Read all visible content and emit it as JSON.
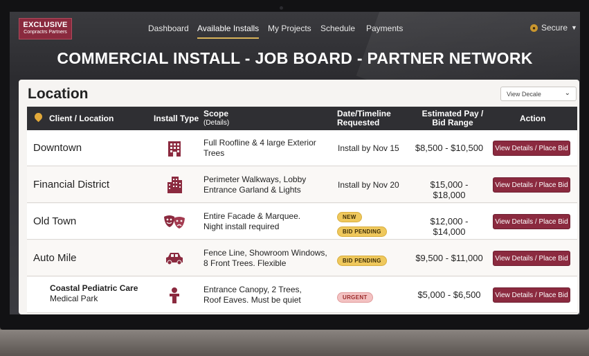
{
  "brand": {
    "line1": "EXCLUSIVE",
    "line2": "Conpractrs Partners"
  },
  "nav": {
    "items": [
      "Dashboard",
      "Available Installs",
      "My Projects",
      "Schedule",
      "Payments"
    ],
    "active": "Available Installs",
    "secure_label": "Secure"
  },
  "page_title": "COMMERCIAL INSTALL - JOB BOARD - PARTNER NETWORK",
  "panel": {
    "heading": "Location",
    "view_select": "View Decale"
  },
  "table": {
    "headers": {
      "location": "Client / Location",
      "install_type": "Install Type",
      "scope": "Scope",
      "scope_sub": "(Details)",
      "timeline_1": "Date/Timeline",
      "timeline_2": "Requested",
      "pay_1": "Estimated Pay /",
      "pay_2": "Bid Range",
      "action": "Action"
    },
    "rows": [
      {
        "location": "Downtown",
        "icon": "office-building-icon",
        "scope_1": "Full Roofline & 4 large Exterior",
        "scope_2": "Trees",
        "timeline": "Install by Nov 15",
        "pay": "$8,500 - $10,500",
        "action": "View Details / Place Bid"
      },
      {
        "location": "Financial District",
        "icon": "skyscraper-icon",
        "scope_1": "Perimeter Walkways, Lobby",
        "scope_2": "Entrance Garland & Lights",
        "timeline": "Install by Nov 20",
        "pay": "$15,000 - $18,000",
        "action": "View Details / Place Bid"
      },
      {
        "location": "Old Town",
        "icon": "theater-masks-icon",
        "scope_1": "Entire Facade & Marquee.",
        "scope_2": "Night install required",
        "badge_1": "NEW",
        "badge_2": "BID PENDING",
        "pay": "$12,000 - $14,000",
        "action": "View Details / Place Bid"
      },
      {
        "location": "Auto Mile",
        "icon": "car-icon",
        "scope_1": "Fence Line, Showroom Windows,",
        "scope_2": "8 Front Trees. Flexible",
        "badge_1": "BID PENDING",
        "pay": "$9,500 - $11,000",
        "action": "View Details / Place Bid"
      },
      {
        "location_1": "Coastal Pediatric Care",
        "location_2": "Medical Park",
        "icon": "person-icon",
        "scope_1": "Entrance Canopy, 2 Trees,",
        "scope_2": "Roof Eaves. Must be quiet",
        "badge_1": "URGENT",
        "pay": "$5,000 - $6,500",
        "action": "View Details / Place Bid"
      }
    ]
  },
  "colors": {
    "accent": "#8b2a3f",
    "header": "#2f2f33",
    "badge_yellow": "#efc85c",
    "badge_red": "#f3c2c2"
  }
}
